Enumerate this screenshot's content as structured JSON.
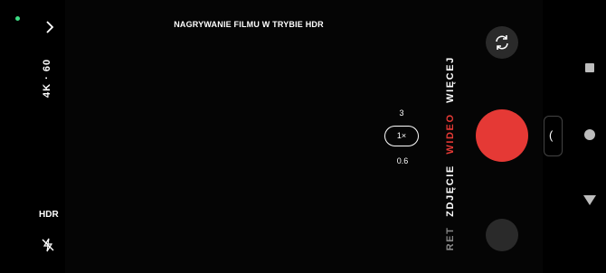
{
  "status": {
    "indicator_color": "#3ddc84"
  },
  "left_bar": {
    "resolution": "4K · 60",
    "hdr": "HDR"
  },
  "viewfinder": {
    "banner": "NAGRYWANIE FILMU W TRYBIE HDR"
  },
  "zoom": {
    "level_high": "3",
    "level_current": "1×",
    "level_low": "0.6"
  },
  "modes": {
    "more": "WIĘCEJ",
    "video": "WIDEO",
    "photo": "ZDJĘCIE",
    "portrait": "RET"
  },
  "panel_tab": {
    "glyph": "("
  },
  "colors": {
    "accent": "#e53935",
    "background": "#000000"
  },
  "icons": {
    "chevron": "chevron-right-icon",
    "flash": "flash-off-icon",
    "switch": "switch-camera-icon"
  }
}
